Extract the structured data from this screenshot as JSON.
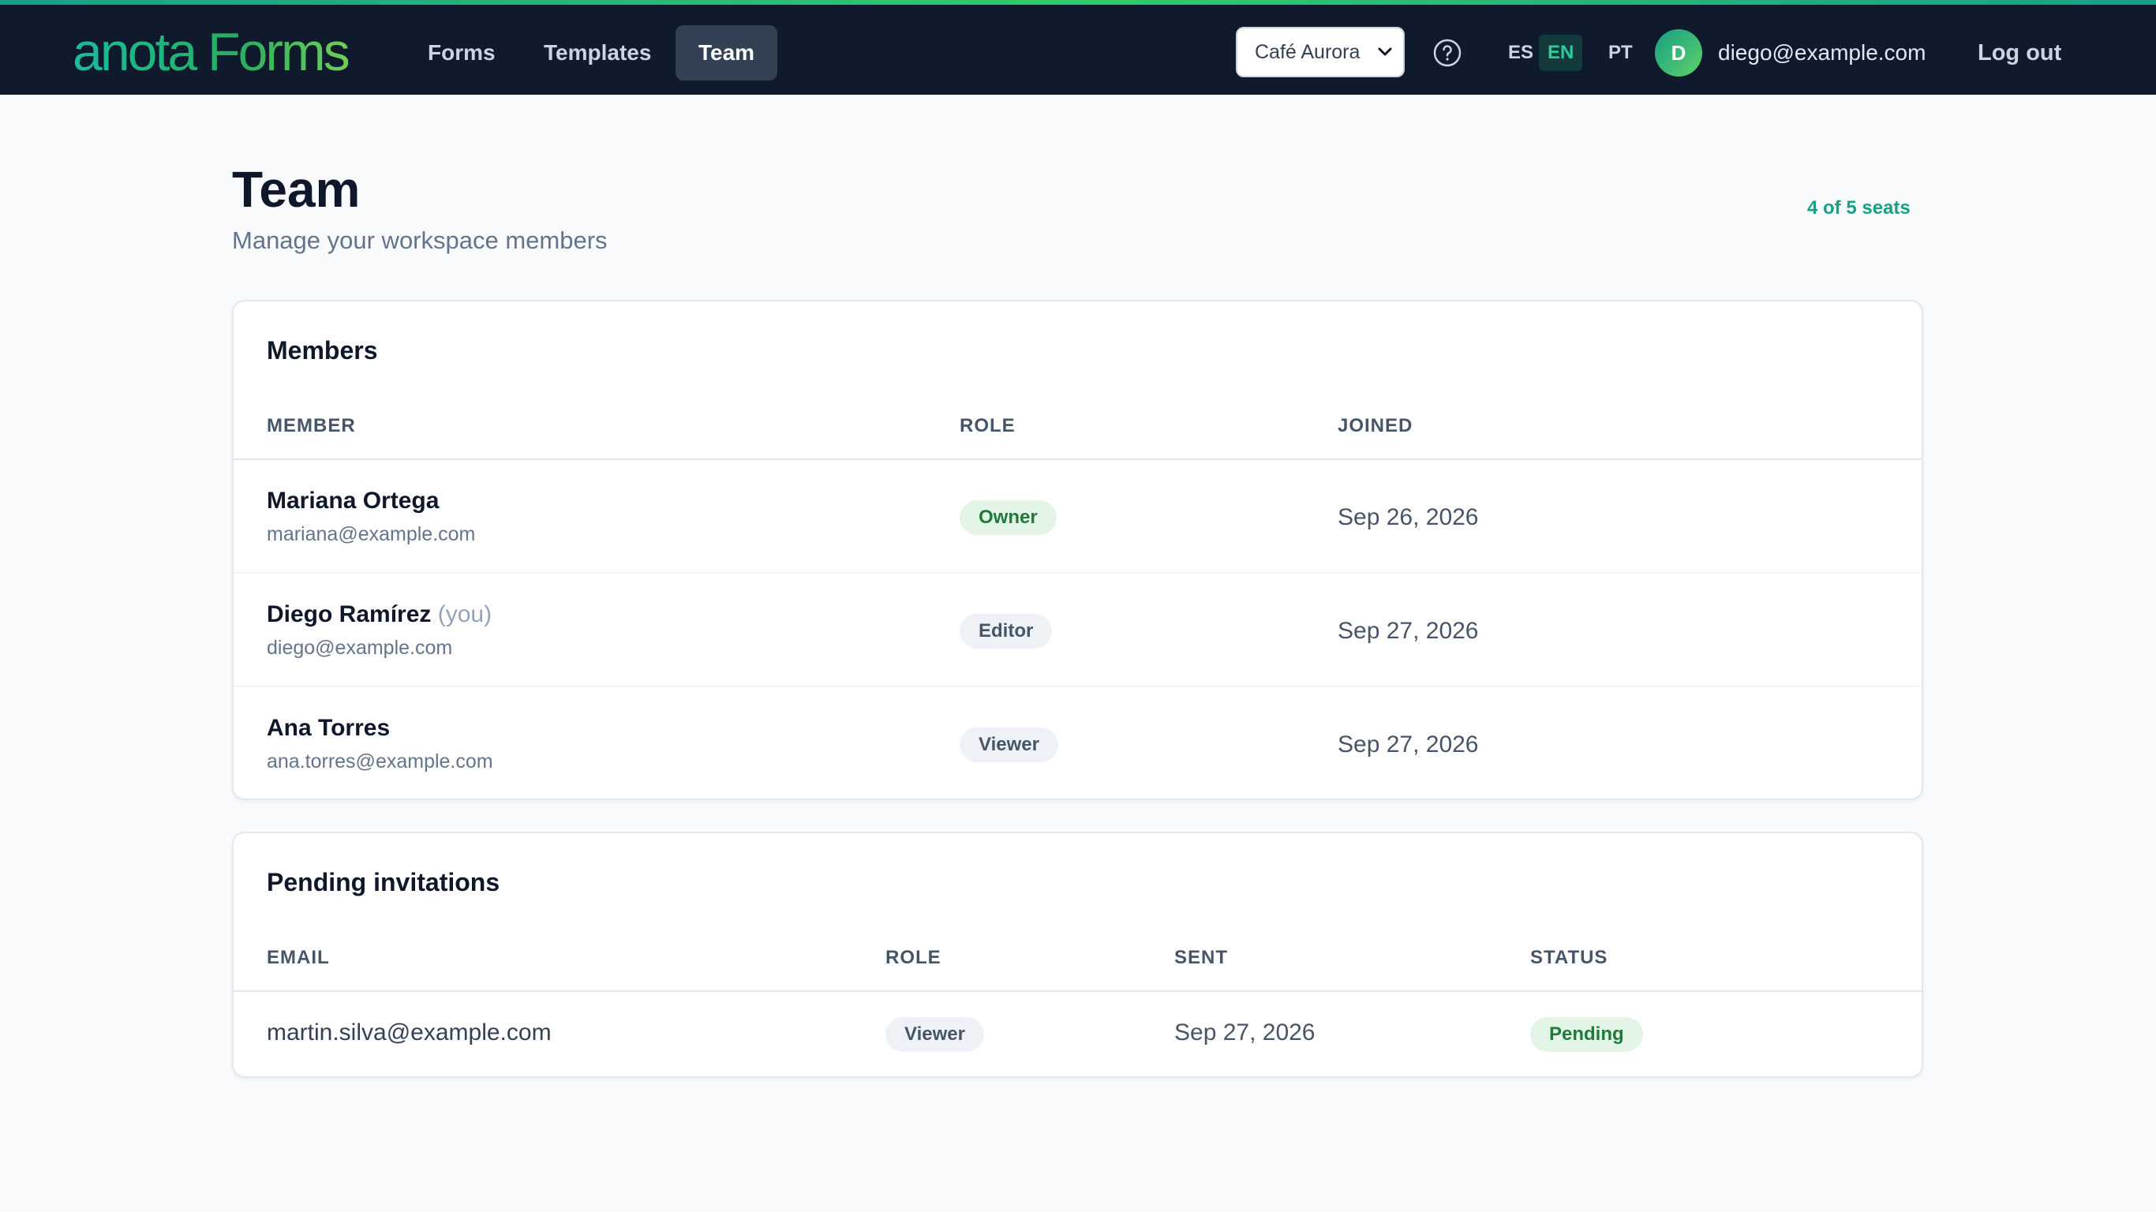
{
  "brand": {
    "logo_text": "anota Forms"
  },
  "nav": {
    "items": [
      {
        "label": "Forms",
        "active": false
      },
      {
        "label": "Templates",
        "active": false
      },
      {
        "label": "Team",
        "active": true
      }
    ]
  },
  "workspace": {
    "selected": "Café Aurora"
  },
  "help": {
    "icon": "question-circle-icon"
  },
  "languages": [
    {
      "code": "ES",
      "active": false
    },
    {
      "code": "EN",
      "active": true
    },
    {
      "code": "PT",
      "active": false
    }
  ],
  "user": {
    "initial": "D",
    "email": "diego@example.com"
  },
  "logout_label": "Log out",
  "page": {
    "title": "Team",
    "subtitle": "Manage your workspace members",
    "seats": "4 of 5 seats"
  },
  "members": {
    "title": "Members",
    "columns": [
      "MEMBER",
      "ROLE",
      "JOINED"
    ],
    "rows": [
      {
        "name": "Mariana Ortega",
        "you": "",
        "email": "mariana@example.com",
        "role": "Owner",
        "joined": "Sep 26, 2026"
      },
      {
        "name": "Diego Ramírez",
        "you": "(you)",
        "email": "diego@example.com",
        "role": "Editor",
        "joined": "Sep 27, 2026"
      },
      {
        "name": "Ana Torres",
        "you": "",
        "email": "ana.torres@example.com",
        "role": "Viewer",
        "joined": "Sep 27, 2026"
      }
    ]
  },
  "invitations": {
    "title": "Pending invitations",
    "columns": [
      "EMAIL",
      "ROLE",
      "SENT",
      "STATUS"
    ],
    "rows": [
      {
        "email": "martin.silva@example.com",
        "role": "Viewer",
        "sent": "Sep 27, 2026",
        "status": "Pending"
      }
    ]
  },
  "colors": {
    "nav_bg": "#0f1b2d",
    "accent": "#16a085",
    "owner_badge": "#e3f5e6",
    "neutral_badge": "#eef2f6"
  }
}
